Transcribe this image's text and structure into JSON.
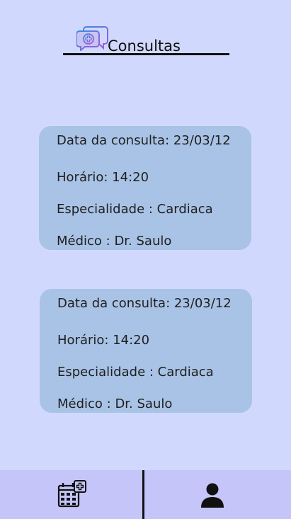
{
  "header": {
    "title": "Consultas",
    "icon": "medical-chat-icon"
  },
  "appointments": [
    {
      "date_label": "Data da consulta: 23/03/12",
      "time_label": "Horário: 14:20",
      "specialty_label": "Especialidade : Cardiaca",
      "doctor_label": "Médico : Dr. Saulo"
    },
    {
      "date_label": "Data da consulta: 23/03/12",
      "time_label": "Horário: 14:20",
      "specialty_label": "Especialidade : Cardiaca",
      "doctor_label": "Médico : Dr. Saulo"
    }
  ],
  "bottom_nav": {
    "items": [
      {
        "icon": "calendar-icon"
      },
      {
        "icon": "user-icon"
      }
    ]
  },
  "colors": {
    "background": "#d0d9fd",
    "card": "#a9c3e6",
    "nav_bar": "#c5c5fa",
    "icon_gradient_start": "#3b8be0",
    "icon_gradient_end": "#a45ad8"
  }
}
